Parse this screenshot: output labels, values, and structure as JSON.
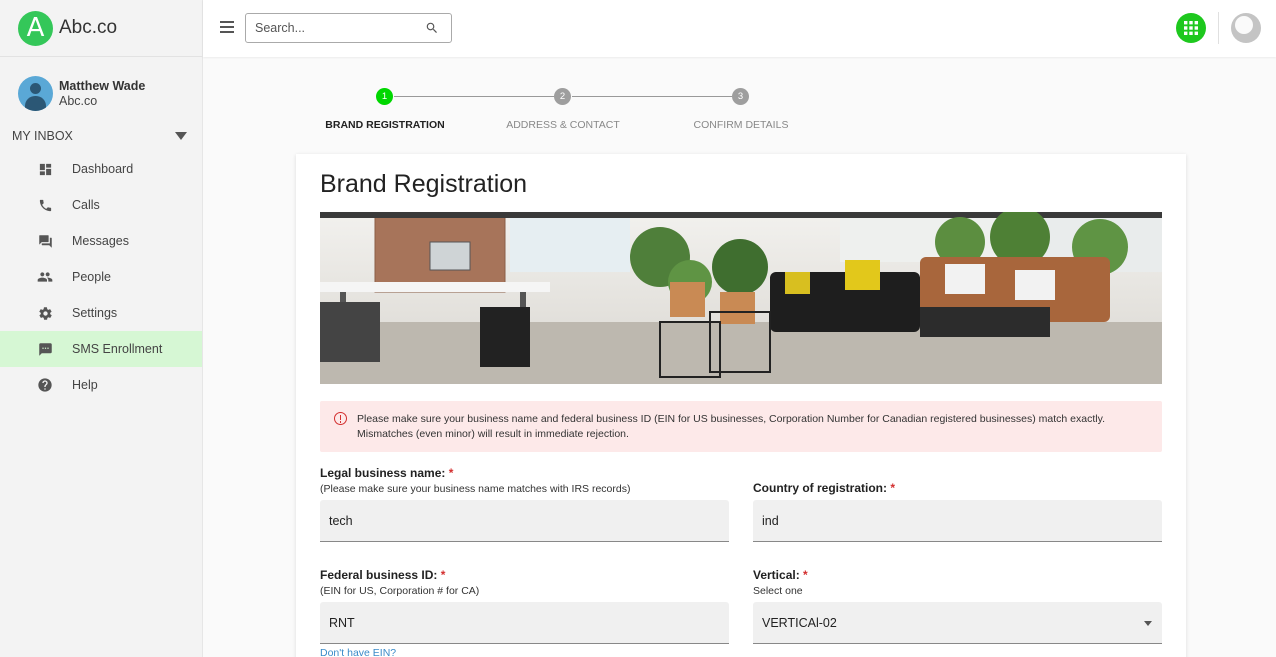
{
  "brand": {
    "logo_letter": "A",
    "name": "Abc.co"
  },
  "user": {
    "name": "Matthew Wade",
    "org": "Abc.co"
  },
  "sidebar": {
    "section_label": "MY INBOX",
    "items": [
      {
        "label": "Dashboard",
        "icon": "dashboard-icon"
      },
      {
        "label": "Calls",
        "icon": "phone-icon"
      },
      {
        "label": "Messages",
        "icon": "chat-icon"
      },
      {
        "label": "People",
        "icon": "people-icon"
      },
      {
        "label": "Settings",
        "icon": "gear-icon"
      },
      {
        "label": "SMS Enrollment",
        "icon": "sms-icon",
        "active": true
      },
      {
        "label": "Help",
        "icon": "help-icon"
      }
    ]
  },
  "topbar": {
    "search_placeholder": "Search..."
  },
  "stepper": {
    "steps": [
      {
        "number": "1",
        "label": "BRAND REGISTRATION",
        "active": true
      },
      {
        "number": "2",
        "label": "ADDRESS & CONTACT",
        "active": false
      },
      {
        "number": "3",
        "label": "CONFIRM DETAILS",
        "active": false
      }
    ]
  },
  "form": {
    "title": "Brand Registration",
    "alert": "Please make sure your business name and federal business ID (EIN for US businesses, Corporation Number for Canadian registered businesses) match exactly. Mismatches (even minor) will result in immediate rejection.",
    "legal_name": {
      "label": "Legal business name:",
      "required": "*",
      "hint": "(Please make sure your business name matches with IRS records)",
      "value": "tech"
    },
    "country": {
      "label": "Country of registration:",
      "required": "*",
      "value": "ind"
    },
    "federal_id": {
      "label": "Federal business ID:",
      "required": "*",
      "hint": "(EIN for US, Corporation # for CA)",
      "value": "RNT",
      "link": "Don't have EIN?"
    },
    "vertical": {
      "label": "Vertical:",
      "required": "*",
      "hint": "Select one",
      "value": "VERTICAl-02"
    }
  },
  "colors": {
    "accent_green": "#00d700",
    "active_nav": "#d6f7d4",
    "alert_bg": "#fde9e9",
    "required": "#d32f2f"
  }
}
